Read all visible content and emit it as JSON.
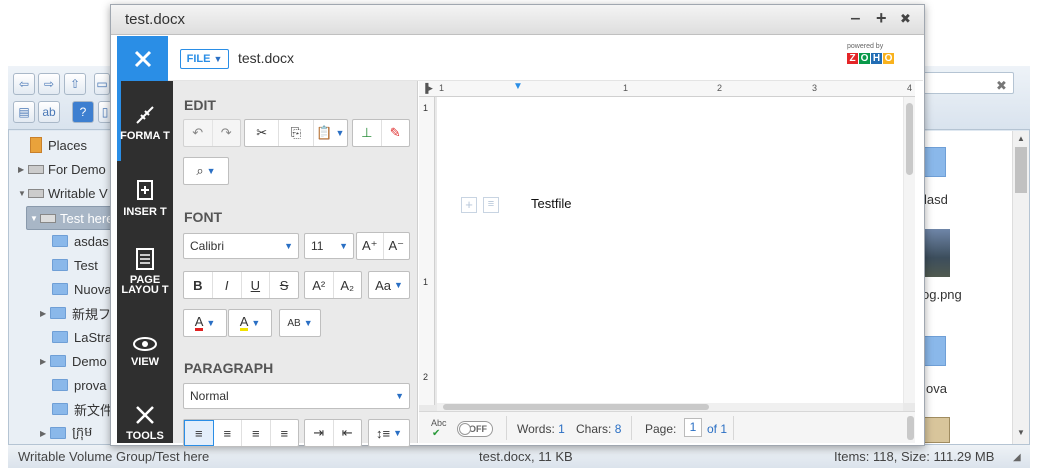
{
  "file_manager": {
    "tree": [
      {
        "label": "Places"
      },
      {
        "label": "For Demo"
      },
      {
        "label": "Writable V"
      },
      {
        "label": "Test here"
      },
      {
        "label": "asdas"
      },
      {
        "label": "Test"
      },
      {
        "label": "Nuova"
      },
      {
        "label": "新規フ"
      },
      {
        "label": "LaStra"
      },
      {
        "label": "Demo"
      },
      {
        "label": "prova"
      },
      {
        "label": "新文件"
      },
      {
        "label": "ក្រុម"
      }
    ],
    "files": [
      {
        "label": "lasd"
      },
      {
        "label": "og.png"
      },
      {
        "label": "ova"
      }
    ],
    "status_left": "Writable Volume Group/Test here",
    "status_center": "test.docx, 11 KB",
    "status_right": "Items: 118, Size: 111.29 MB"
  },
  "window": {
    "title": "test.docx",
    "controls": {
      "minimize": "‒",
      "maximize": "+",
      "close": "✖"
    }
  },
  "appbar": {
    "file_label": "FILE",
    "doc_name": "test.docx",
    "powered_by": "powered by",
    "brand": "ZOHO"
  },
  "sidebar": {
    "items": [
      {
        "label": "FORMA T",
        "icon": "brush-icon"
      },
      {
        "label": "INSER T",
        "icon": "insert-icon"
      },
      {
        "label": "PAGE LAYOU T",
        "icon": "page-layout-icon"
      },
      {
        "label": "VIEW",
        "icon": "eye-icon"
      },
      {
        "label": "TOOLS",
        "icon": "tools-icon"
      }
    ]
  },
  "panel": {
    "edit_title": "EDIT",
    "font_title": "FONT",
    "font_name": "Calibri",
    "font_size": "11",
    "paragraph_title": "PARAGRAPH",
    "paragraph_style": "Normal"
  },
  "document": {
    "text": "Testfile",
    "ruler_numbers": [
      "1",
      "1",
      "2",
      "3",
      "4"
    ],
    "ruler_left_numbers": [
      "1",
      "1",
      "2"
    ]
  },
  "docbar": {
    "spell": "Abc",
    "toggle": "OFF",
    "words_label": "Words:",
    "words": "1",
    "chars_label": "Chars:",
    "chars": "8",
    "page_label": "Page:",
    "page": "1",
    "page_of": "of 1"
  },
  "colors": {
    "accent": "#2a8ee6",
    "sidebar": "#2f2f2f"
  }
}
